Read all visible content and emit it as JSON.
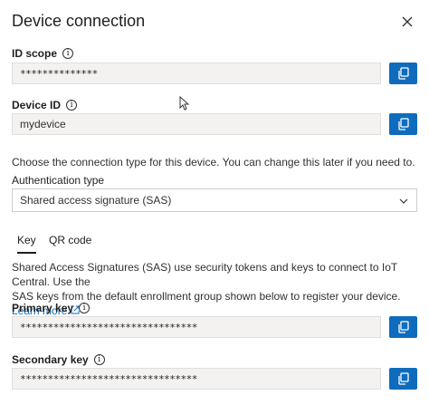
{
  "dialog": {
    "title": "Device connection",
    "close_icon": "close-icon"
  },
  "id_scope": {
    "label": "ID scope",
    "value": "**************"
  },
  "device_id": {
    "label": "Device ID",
    "value": "mydevice"
  },
  "connection": {
    "description": "Choose the connection type for this device. You can change this later if you need to.",
    "auth_label": "Authentication type",
    "auth_selected": "Shared access signature (SAS)"
  },
  "tabs": [
    {
      "label": "Key",
      "active": true
    },
    {
      "label": "QR code",
      "active": false
    }
  ],
  "sas": {
    "description_line1": "Shared Access Signatures (SAS) use security tokens and keys to connect to IoT Central. Use the",
    "description_line2": "SAS keys from the default enrollment group shown below to register your device.",
    "learn_more": "Learn more"
  },
  "primary_key": {
    "label": "Primary key",
    "value": "********************************"
  },
  "secondary_key": {
    "label": "Secondary key",
    "value": "********************************"
  },
  "colors": {
    "accent": "#0f6cbd",
    "field_bg": "#f3f2f1"
  }
}
